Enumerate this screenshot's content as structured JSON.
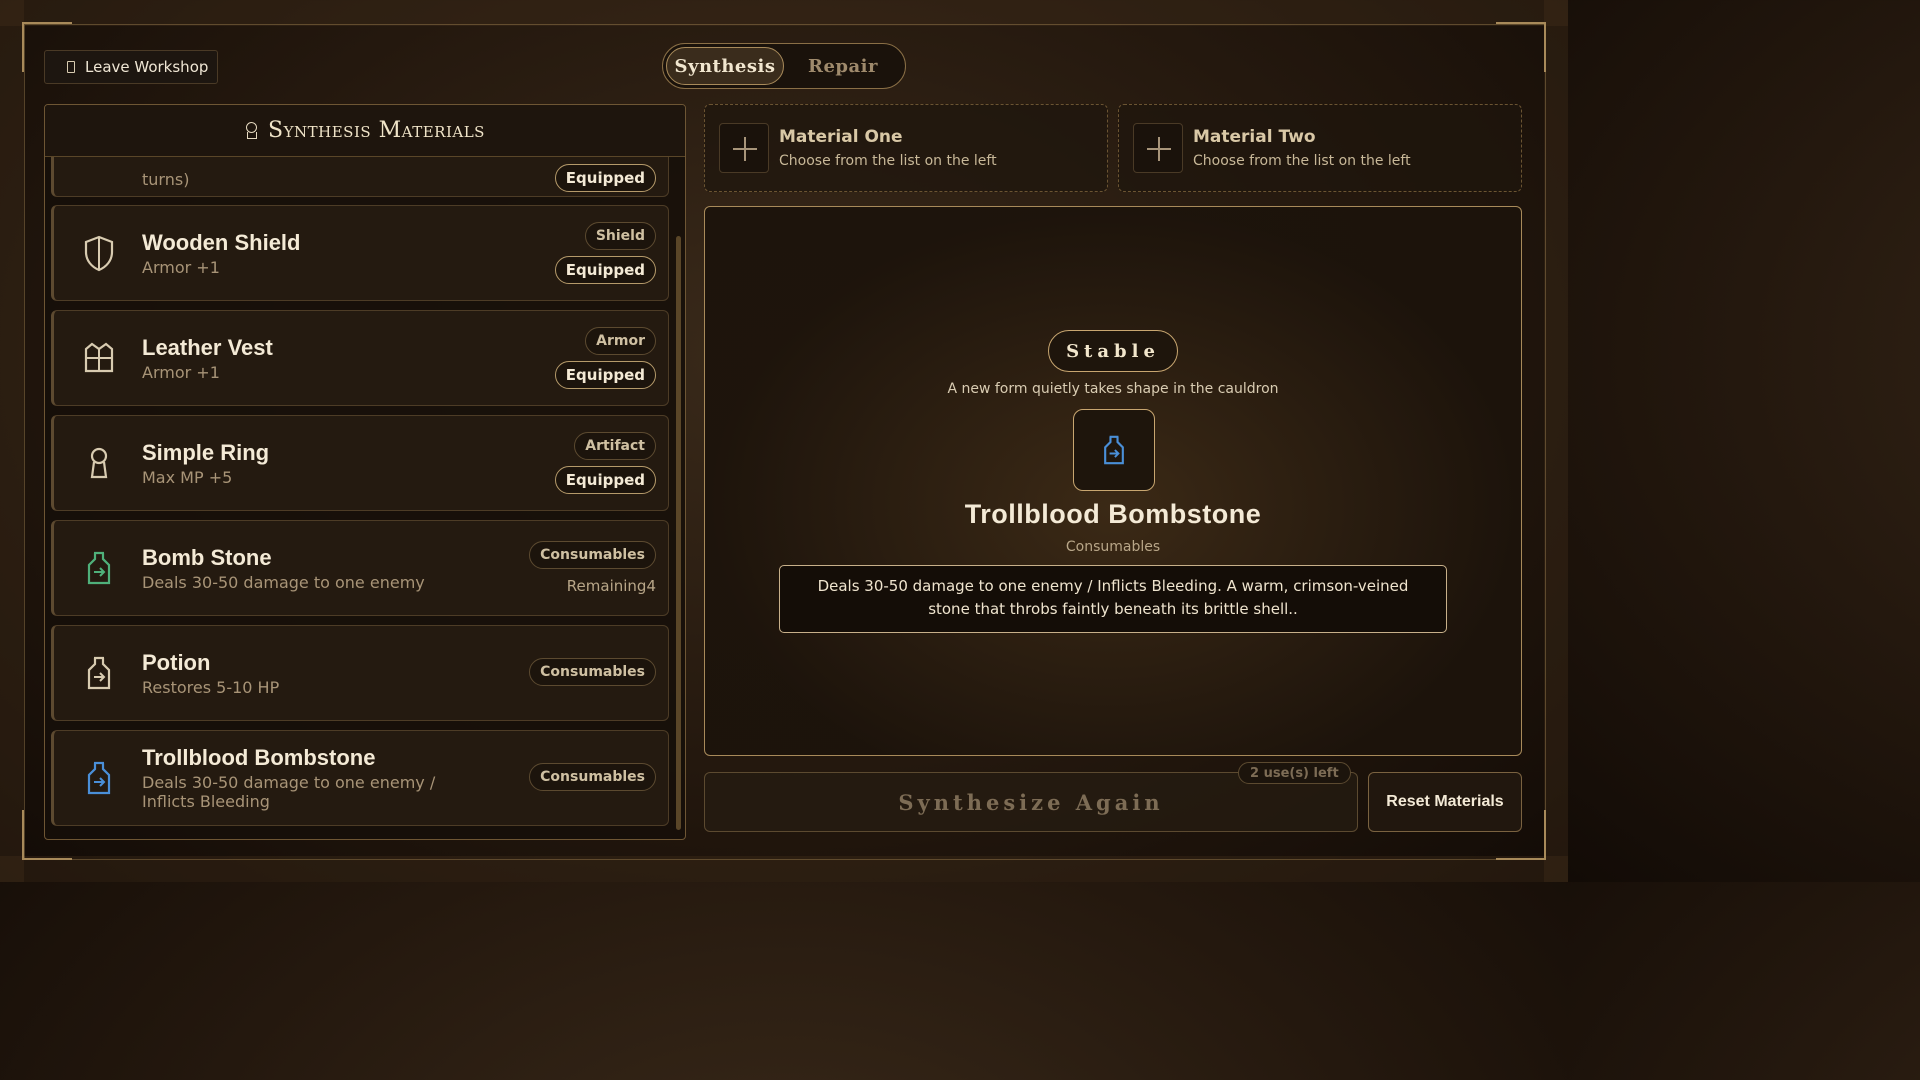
{
  "header": {
    "leave_label": "Leave Workshop",
    "tabs": [
      {
        "label": "Synthesis",
        "active": true
      },
      {
        "label": "Repair",
        "active": false
      }
    ]
  },
  "materials_panel": {
    "title": "Synthesis Materials",
    "partial_item": {
      "desc": "turns)",
      "tag": "Equipped"
    },
    "items": [
      {
        "name": "Wooden Shield",
        "desc": "Armor +1",
        "category": "Shield",
        "status": "Equipped",
        "icon": "shield-icon"
      },
      {
        "name": "Leather Vest",
        "desc": "Armor +1",
        "category": "Armor",
        "status": "Equipped",
        "icon": "vest-icon"
      },
      {
        "name": "Simple Ring",
        "desc": "Max MP +5",
        "category": "Artifact",
        "status": "Equipped",
        "icon": "ring-icon"
      },
      {
        "name": "Bomb Stone",
        "desc": "Deals 30-50 damage to one enemy",
        "category": "Consumables",
        "remaining": "Remaining4",
        "icon": "bottle-icon",
        "icon_color": "#4fb07a"
      },
      {
        "name": "Potion",
        "desc": "Restores 5-10 HP",
        "category": "Consumables",
        "icon": "bottle-icon",
        "icon_color": "#d8cbb0"
      },
      {
        "name": "Trollblood Bombstone",
        "desc": "Deals 30-50 damage to one enemy / Inflicts Bleeding",
        "category": "Consumables",
        "icon": "bottle-icon",
        "icon_color": "#4a8fd8"
      }
    ]
  },
  "slots": [
    {
      "title": "Material One",
      "hint": "Choose from the list on the left"
    },
    {
      "title": "Material Two",
      "hint": "Choose from the list on the left"
    }
  ],
  "result": {
    "stability": "Stable",
    "message": "A new form quietly takes shape in the cauldron",
    "name": "Trollblood Bombstone",
    "category": "Consumables",
    "description": "Deals 30-50 damage to one enemy / Inflicts Bleeding. A warm, crimson-veined stone that throbs faintly beneath its brittle shell..",
    "icon": "bottle-icon",
    "icon_color": "#4a8fd8"
  },
  "actions": {
    "synthesize_label": "Synthesize Again",
    "uses_left": "2 use(s) left",
    "reset_label": "Reset Materials"
  },
  "colors": {
    "accent_gold": "#a88a5a",
    "panel_bg": "#241a10",
    "text_primary": "#f4ead6"
  }
}
